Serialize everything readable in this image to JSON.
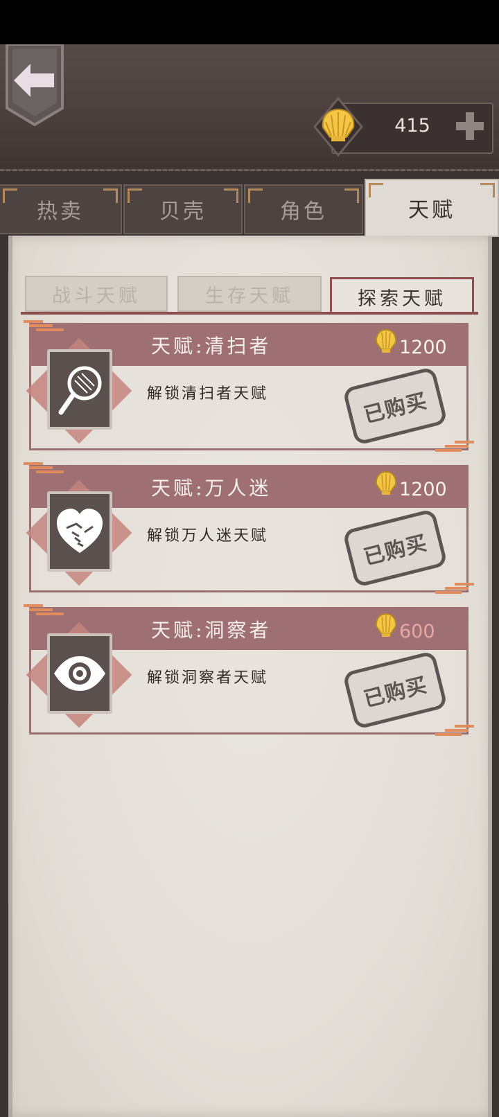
{
  "currency": {
    "value": "415"
  },
  "tabs": [
    {
      "label": "热卖",
      "active": false
    },
    {
      "label": "贝壳",
      "active": false
    },
    {
      "label": "角色",
      "active": false
    },
    {
      "label": "天赋",
      "active": true
    }
  ],
  "subtabs": [
    {
      "label": "战斗天赋",
      "active": false
    },
    {
      "label": "生存天赋",
      "active": false
    },
    {
      "label": "探索天赋",
      "active": true
    }
  ],
  "talents": [
    {
      "name": "天赋:清扫者",
      "price": "1200",
      "desc": "解锁清扫者天赋",
      "status": "已购买",
      "icon": "magnifier-icon"
    },
    {
      "name": "天赋:万人迷",
      "price": "1200",
      "desc": "解锁万人迷天赋",
      "status": "已购买",
      "icon": "heart-handshake-icon"
    },
    {
      "name": "天赋:洞察者",
      "price": "600",
      "desc": "解锁洞察者天赋",
      "status": "已购买",
      "icon": "eye-icon"
    }
  ],
  "colors": {
    "accent": "#9e7073",
    "paper": "#e3ded7",
    "header": "#4a3f3d",
    "price_low": "#e9a7a4"
  }
}
